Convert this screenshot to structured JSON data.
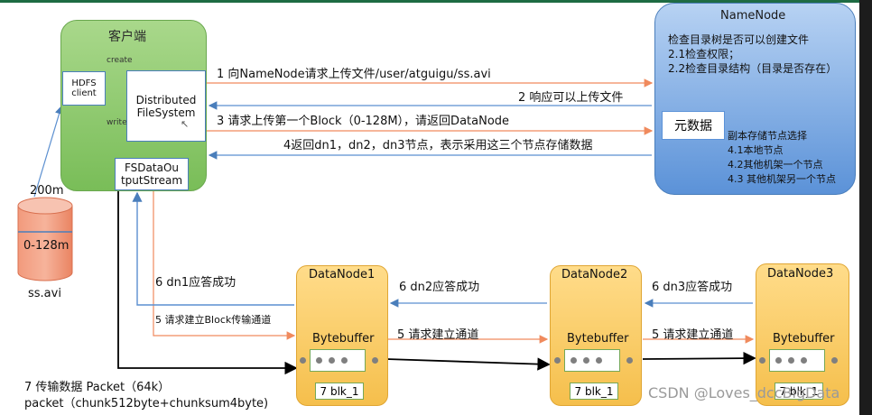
{
  "client": {
    "title": "客户端",
    "hdfs_client": [
      "HDFS",
      "client"
    ],
    "create": "create",
    "write": "write",
    "dfs": [
      "Distributed",
      "FileSystem"
    ],
    "fsdos": [
      "FSDataOu",
      "tputStream"
    ]
  },
  "file": {
    "size_label": "200m",
    "block_label": "0-128m",
    "name": "ss.avi"
  },
  "namenode": {
    "title": "NameNode",
    "lines": [
      "检查目录树是否可以创建文件",
      "2.1检查权限；",
      "2.2检查目录结构（目录是否存在）"
    ],
    "metadata": "元数据",
    "replica_lines": [
      "副本存储节点选择",
      "4.1本地节点",
      "4.2其他机架一个节点",
      "4.3 其他机架另一个节点"
    ]
  },
  "steps": {
    "s1": "1 向NameNode请求上传文件/user/atguigu/ss.avi",
    "s2": "2 响应可以上传文件",
    "s3": "3 请求上传第一个Block（0-128M），请返回DataNode",
    "s4": "4返回dn1，dn2，dn3节点，表示采用这三个节点存储数据",
    "s5_client": "5 请求建立Block传输通道",
    "s5_dn1": "5 请求建立通道",
    "s5_dn2": "5 请求建立通道",
    "s6_client": "6 dn1应答成功",
    "s6_dn2": "6 dn2应答成功",
    "s6_dn3": "6 dn3应答成功",
    "s7_line1": "7 传输数据 Packet（64k）",
    "s7_line2": "packet（chunk512byte+chunksum4byte)"
  },
  "datanodes": [
    {
      "title": "DataNode1",
      "buffer": "Bytebuffer",
      "block": "7 blk_1"
    },
    {
      "title": "DataNode2",
      "buffer": "Bytebuffer",
      "block": "7 blk_1"
    },
    {
      "title": "DataNode3",
      "buffer": "Bytebuffer",
      "block": "7 blk_1"
    }
  ],
  "watermark": "CSDN @Loves_dccBigData",
  "colors": {
    "request_arrow": "#f4a582",
    "response_arrow": "#5b8fd0",
    "data_arrow": "#000000"
  }
}
